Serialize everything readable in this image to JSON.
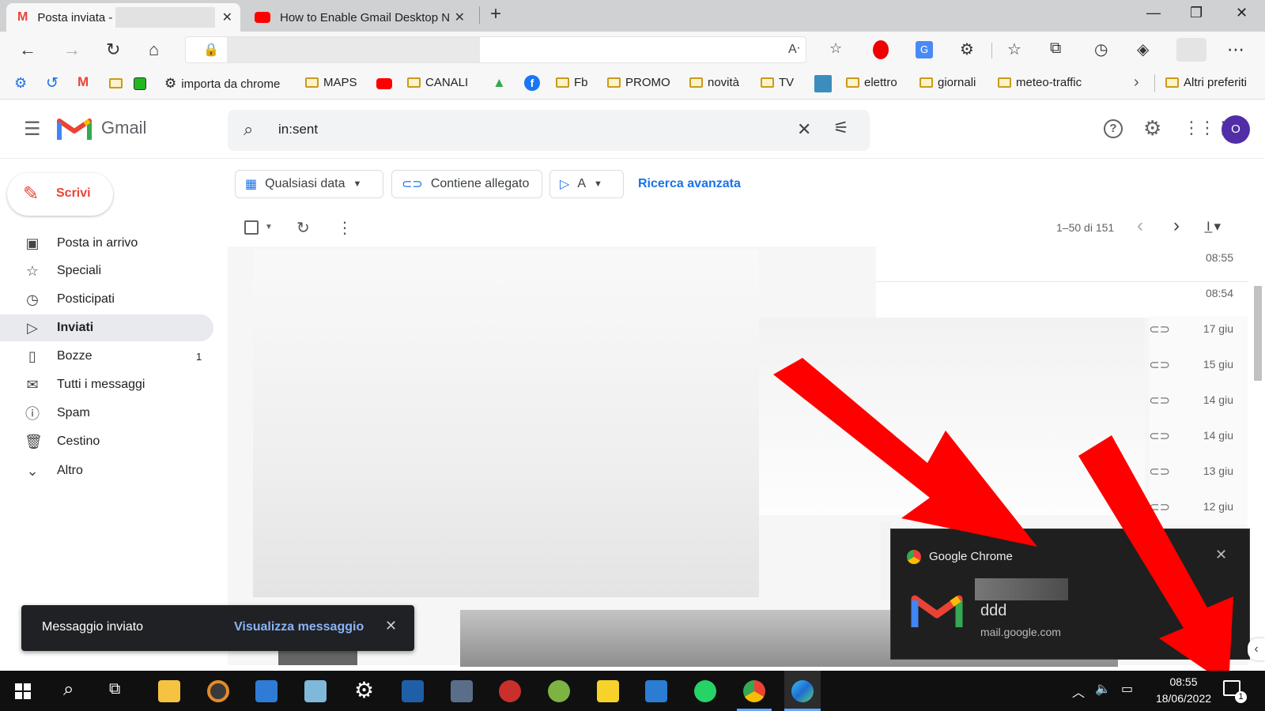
{
  "browser": {
    "tabs": [
      {
        "title": "Posta inviata -",
        "active": true
      },
      {
        "title": "How to Enable Gmail Desktop N",
        "active": false
      }
    ],
    "bookmarks": [
      {
        "label": "importa da chrome",
        "type": "gear"
      },
      {
        "label": "MAPS",
        "type": "folder"
      },
      {
        "label": "CANALI",
        "type": "folder"
      },
      {
        "label": "Fb",
        "type": "folder"
      },
      {
        "label": "PROMO",
        "type": "folder"
      },
      {
        "label": "novità",
        "type": "folder"
      },
      {
        "label": "TV",
        "type": "folder"
      },
      {
        "label": "elettro",
        "type": "folder"
      },
      {
        "label": "giornali",
        "type": "folder"
      },
      {
        "label": "meteo-traffic",
        "type": "folder"
      },
      {
        "label": "Altri preferiti",
        "type": "folder"
      }
    ]
  },
  "gmail": {
    "logo_text": "Gmail",
    "search_query": "in:sent",
    "account_initial": "O",
    "compose_label": "Scrivi",
    "nav": [
      {
        "label": "Posta in arrivo",
        "icon": "inbox-icon",
        "glyph": "▣",
        "active": false,
        "count": ""
      },
      {
        "label": "Speciali",
        "icon": "star-icon",
        "glyph": "☆",
        "active": false,
        "count": ""
      },
      {
        "label": "Posticipati",
        "icon": "clock-icon",
        "glyph": "◷",
        "active": false,
        "count": ""
      },
      {
        "label": "Inviati",
        "icon": "send-icon",
        "glyph": "▷",
        "active": true,
        "count": ""
      },
      {
        "label": "Bozze",
        "icon": "draft-icon",
        "glyph": "▯",
        "active": false,
        "count": "1"
      },
      {
        "label": "Tutti i messaggi",
        "icon": "mail-icon",
        "glyph": "✉",
        "active": false,
        "count": ""
      },
      {
        "label": "Spam",
        "icon": "spam-icon",
        "glyph": "ⓘ",
        "active": false,
        "count": ""
      },
      {
        "label": "Cestino",
        "icon": "trash-icon",
        "glyph": "🗑",
        "active": false,
        "count": ""
      },
      {
        "label": "Altro",
        "icon": "chevron-down-icon",
        "glyph": "⌄",
        "active": false,
        "count": ""
      }
    ],
    "filters": {
      "date": "Qualsiasi data",
      "attachment": "Contiene allegato",
      "to": "A",
      "advanced": "Ricerca avanzata"
    },
    "pagination": "1–50 di 151",
    "rows": [
      {
        "time": "08:55",
        "attach": false
      },
      {
        "time": "08:54",
        "attach": false
      },
      {
        "time": "17 giu",
        "attach": true
      },
      {
        "time": "15 giu",
        "attach": true
      },
      {
        "time": "14 giu",
        "attach": true
      },
      {
        "time": "14 giu",
        "attach": true
      },
      {
        "time": "13 giu",
        "attach": true
      },
      {
        "time": "12 giu",
        "attach": true
      }
    ],
    "snackbar": {
      "message": "Messaggio inviato",
      "action": "Visualizza messaggio"
    }
  },
  "notification": {
    "app": "Google Chrome",
    "body": "ddd",
    "source": "mail.google.com"
  },
  "taskbar": {
    "time": "08:55",
    "date": "18/06/2022",
    "notification_count": "1"
  },
  "colors": {
    "gmail_red": "#ea4335",
    "gmail_blue": "#1a73e8",
    "arrow_red": "#ff0000"
  }
}
